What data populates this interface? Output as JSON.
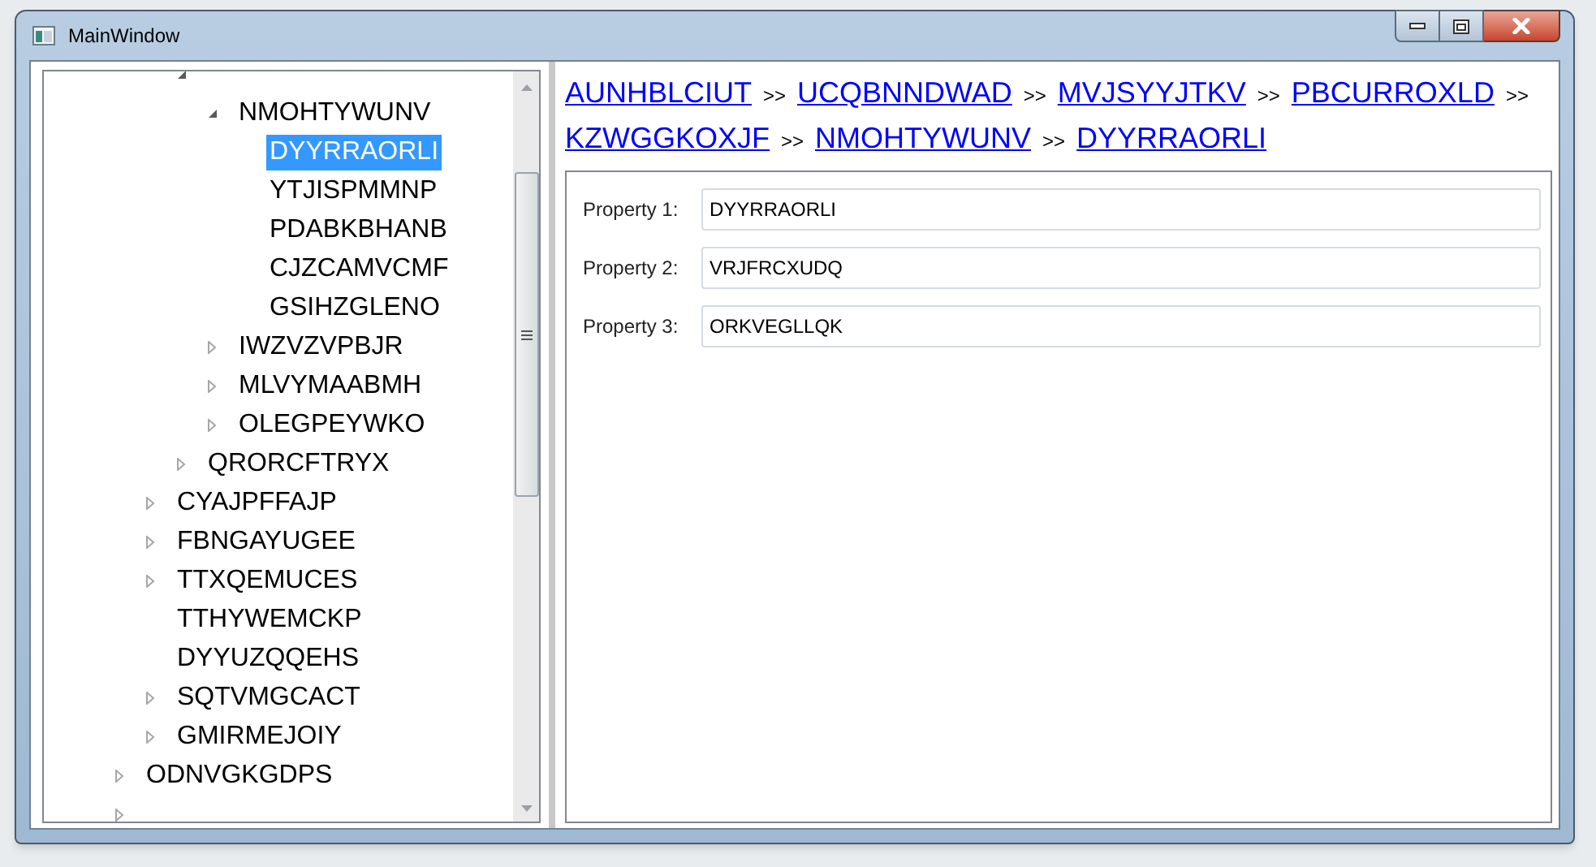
{
  "window": {
    "title": "MainWindow"
  },
  "tree": {
    "items": [
      {
        "children": [
          {
            "children": [
              {
                "expanded": true,
                "children": [
                  {
                    "label": "NMOHTYWUNV",
                    "expanded": true,
                    "selected": false,
                    "children": [
                      {
                        "label": "DYYRRAORLI",
                        "selected": true
                      },
                      {
                        "label": "YTJISPMMNP",
                        "selected": false
                      },
                      {
                        "label": "PDABKBHANB",
                        "selected": false
                      },
                      {
                        "label": "CJZCAMVCMF",
                        "selected": false
                      },
                      {
                        "label": "GSIHZGLENO",
                        "selected": false
                      }
                    ]
                  },
                  {
                    "label": "IWZVZVPBJR",
                    "expanded": false,
                    "selected": false
                  },
                  {
                    "label": "MLVYMAABMH",
                    "expanded": false,
                    "selected": false
                  },
                  {
                    "label": "OLEGPEYWKO",
                    "expanded": false,
                    "selected": false
                  }
                ]
              },
              {
                "label": "QRORCFTRYX",
                "expanded": false,
                "selected": false
              }
            ]
          },
          {
            "label": "CYAJPFFAJP",
            "expanded": false,
            "selected": false
          },
          {
            "label": "FBNGAYUGEE",
            "expanded": false,
            "selected": false
          },
          {
            "label": "TTXQEMUCES",
            "expanded": false,
            "selected": false
          },
          {
            "label": "TTHYWEMCKP",
            "selected": false
          },
          {
            "label": "DYYUZQQEHS",
            "selected": false
          },
          {
            "label": "SQTVMGCACT",
            "expanded": false,
            "selected": false
          },
          {
            "label": "GMIRMEJOIY",
            "expanded": false,
            "selected": false
          }
        ]
      },
      {
        "label": "ODNVGKGDPS",
        "expanded": false,
        "selected": false
      },
      {
        "expanded": false
      }
    ]
  },
  "breadcrumb": {
    "separator": ">>",
    "links": [
      "AUNHBLCIUT",
      "UCQBNNDWAD",
      "MVJSYYJTKV",
      "PBCURROXLD",
      "KZWGGKOXJF",
      "NMOHTYWUNV",
      "DYYRRAORLI"
    ]
  },
  "properties": [
    {
      "label": "Property 1:",
      "value": "DYYRRAORLI"
    },
    {
      "label": "Property 2:",
      "value": "VRJFRCXUDQ"
    },
    {
      "label": "Property 3:",
      "value": "ORKVEGLLQK"
    }
  ]
}
